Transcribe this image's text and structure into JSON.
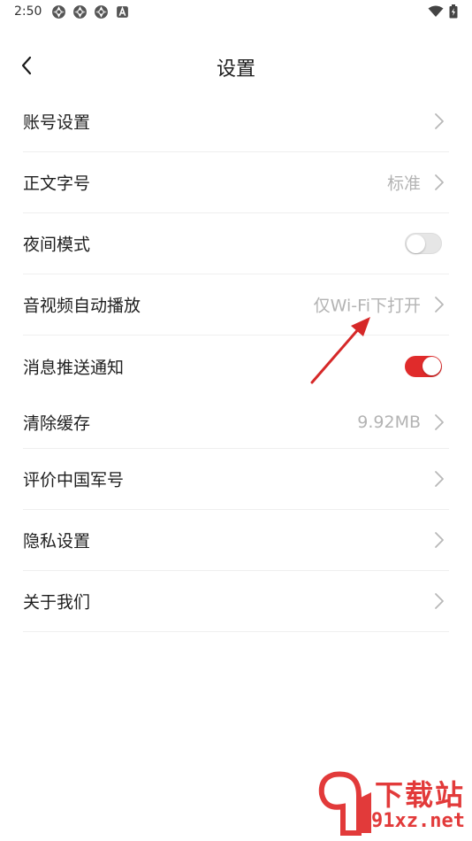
{
  "status_bar": {
    "time": "2:50",
    "icons_left": [
      "aperture-icon",
      "aperture-icon",
      "aperture-icon",
      "a-box-icon"
    ],
    "icons_right": [
      "wifi-icon",
      "battery-icon"
    ]
  },
  "header": {
    "title": "设置",
    "back_icon": "chevron-left-icon"
  },
  "settings": [
    {
      "label": "账号设置",
      "value": "",
      "control": "chevron"
    },
    {
      "label": "正文字号",
      "value": "标准",
      "control": "chevron"
    },
    {
      "label": "夜间模式",
      "value": "",
      "control": "toggle",
      "on": false
    },
    {
      "label": "音视频自动播放",
      "value": "仅Wi-Fi下打开",
      "control": "chevron"
    },
    {
      "label": "消息推送通知",
      "value": "",
      "control": "toggle",
      "on": true
    },
    {
      "label": "清除缓存",
      "value": "9.92MB",
      "control": "chevron"
    },
    {
      "label": "评价中国军号",
      "value": "",
      "control": "chevron"
    },
    {
      "label": "隐私设置",
      "value": "",
      "control": "chevron"
    },
    {
      "label": "关于我们",
      "value": "",
      "control": "chevron"
    }
  ],
  "watermark": {
    "top": "下载站",
    "bottom": "91xz.net"
  },
  "colors": {
    "accent": "#e02b2b",
    "annotation_arrow": "#d62828",
    "value_text": "#b3b3b3",
    "divider": "#efefef"
  }
}
